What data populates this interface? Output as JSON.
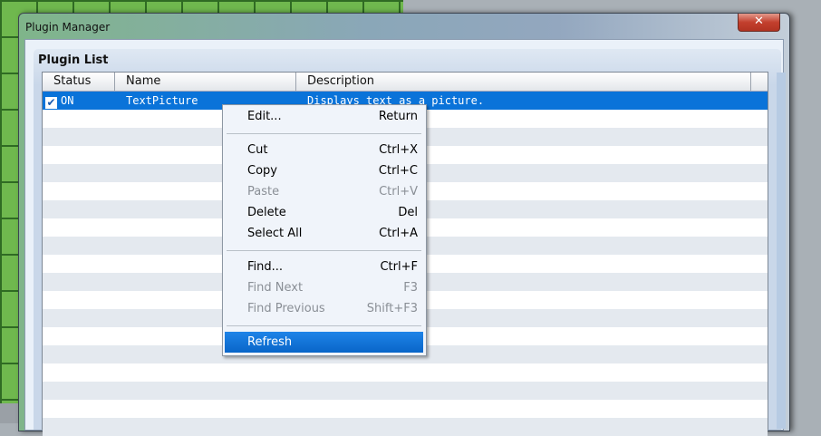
{
  "window": {
    "title": "Plugin Manager",
    "close_icon": "close-icon"
  },
  "group": {
    "label": "Plugin List"
  },
  "table": {
    "columns": [
      "Status",
      "Name",
      "Description"
    ],
    "rows": [
      {
        "checked": true,
        "status": "ON",
        "name": "TextPicture",
        "description": "Displays text as a picture."
      }
    ]
  },
  "context_menu": {
    "items": [
      {
        "label": "Edit...",
        "shortcut": "Return",
        "disabled": false
      },
      {
        "label": "Cut",
        "shortcut": "Ctrl+X",
        "disabled": false
      },
      {
        "label": "Copy",
        "shortcut": "Ctrl+C",
        "disabled": false
      },
      {
        "label": "Paste",
        "shortcut": "Ctrl+V",
        "disabled": true
      },
      {
        "label": "Delete",
        "shortcut": "Del",
        "disabled": false
      },
      {
        "label": "Select All",
        "shortcut": "Ctrl+A",
        "disabled": false
      },
      {
        "label": "Find...",
        "shortcut": "Ctrl+F",
        "disabled": false
      },
      {
        "label": "Find Next",
        "shortcut": "F3",
        "disabled": true
      },
      {
        "label": "Find Previous",
        "shortcut": "Shift+F3",
        "disabled": true
      },
      {
        "label": "Refresh",
        "shortcut": "",
        "disabled": false,
        "highlighted": true
      }
    ]
  }
}
